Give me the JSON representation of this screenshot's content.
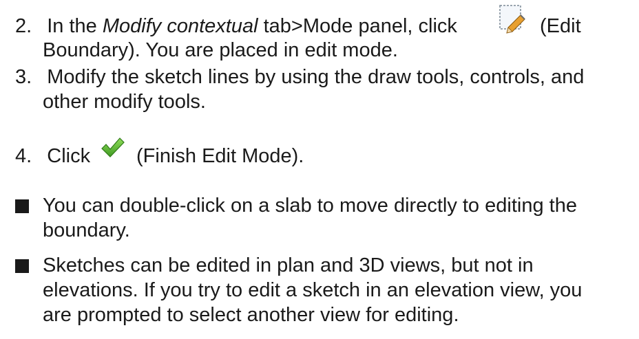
{
  "steps": {
    "step2": {
      "number": "2.",
      "prefix": "In the ",
      "italic": "Modify contextual",
      "mid": " tab>Mode panel, click",
      "suffix": "(Edit",
      "line2": "Boundary). You are placed in edit mode.",
      "icon": "edit-boundary-icon"
    },
    "step3": {
      "number": "3.",
      "line1": "Modify the sketch lines by using the draw tools, controls, and",
      "line2": "other modify tools."
    },
    "step4": {
      "number": "4.",
      "prefix": "Click",
      "suffix": "(Finish Edit Mode).",
      "icon": "finish-edit-mode-icon"
    }
  },
  "notes": [
    {
      "line1": "You can double-click on a slab to move directly to editing the",
      "line2": "boundary."
    },
    {
      "line1": "Sketches can be edited in plan and 3D views, but not in",
      "line2": "elevations. If you try to edit a sketch in an elevation view, you",
      "line3": "are prompted to select another view for editing."
    }
  ],
  "colors": {
    "text": "#1a1a1a",
    "check_green": "#4caf2a",
    "pencil_orange": "#e8a030"
  }
}
